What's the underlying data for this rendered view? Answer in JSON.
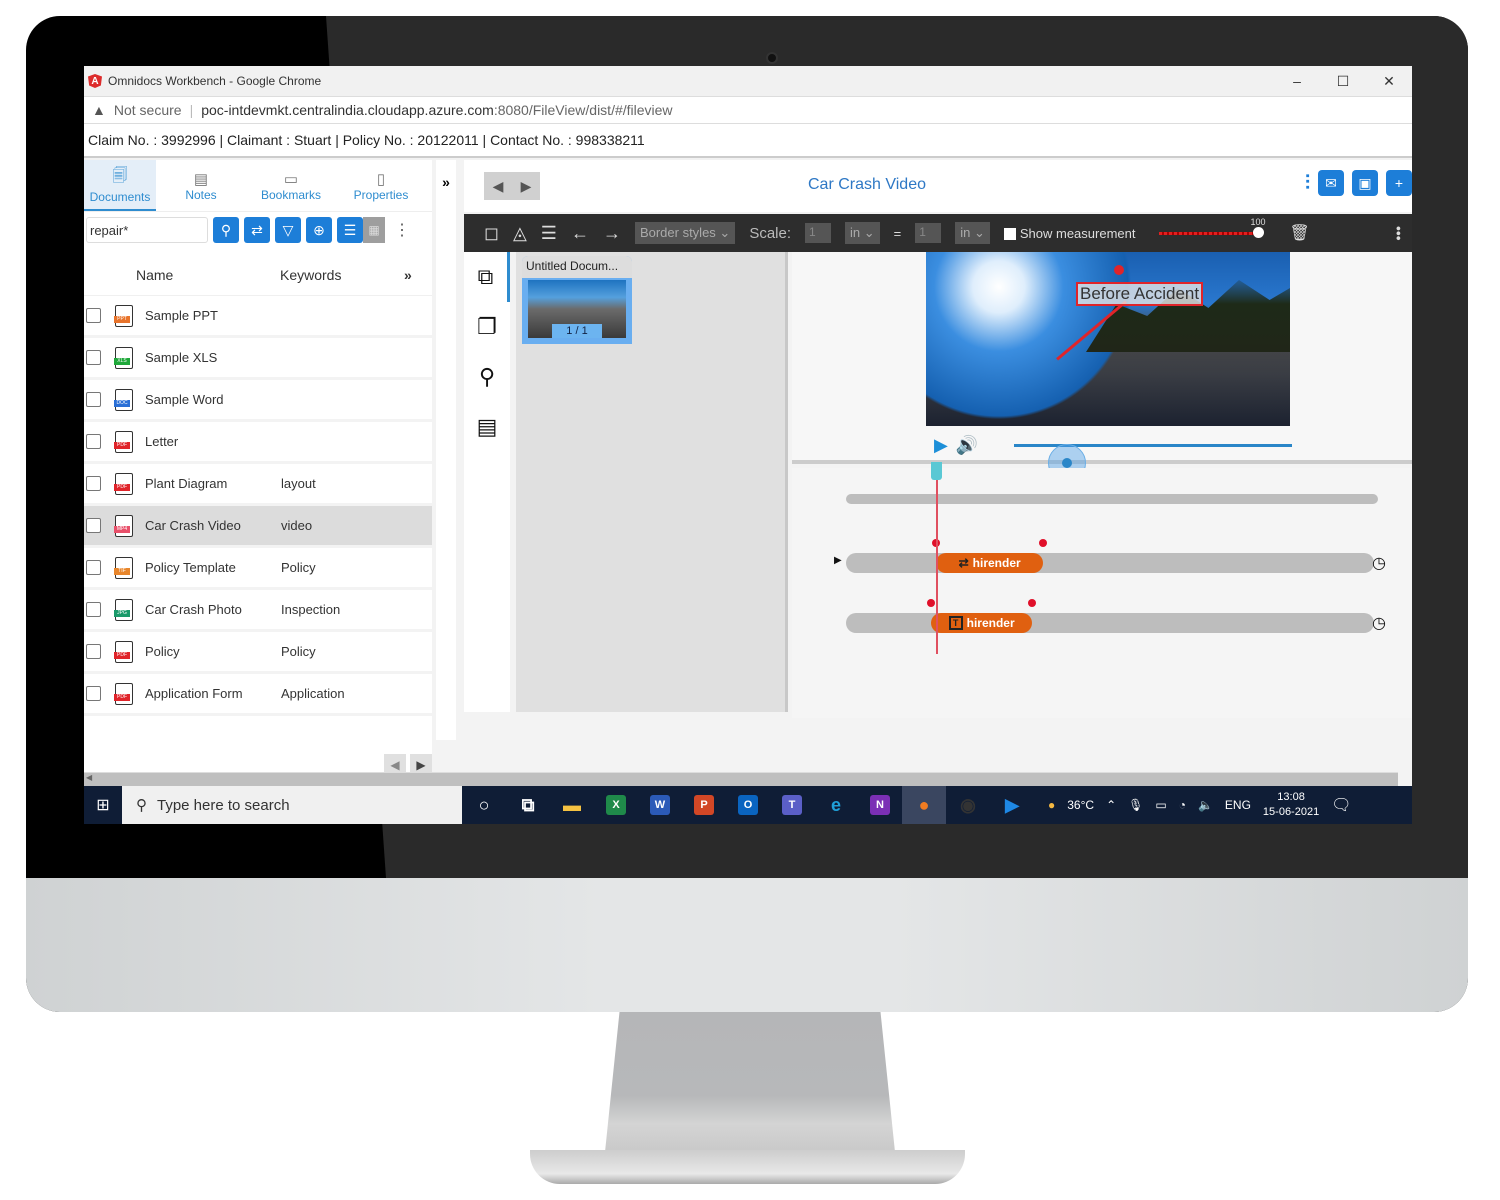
{
  "window": {
    "title": "Omnidocs Workbench - Google Chrome",
    "controls": {
      "minimize": "–",
      "maximize": "☐",
      "close": "✕"
    }
  },
  "address_bar": {
    "security_label": "Not secure",
    "url_host": "poc-intdevmkt.centralindia.cloudapp.azure.com",
    "url_path": ":8080/FileView/dist/#/fileview"
  },
  "claim_bar": {
    "text": "Claim No. : 3992996 | Claimant : Stuart | Policy No. : 20122011 | Contact No. : 998338211"
  },
  "left_panel": {
    "tabs": [
      {
        "label": "Documents",
        "icon": "documents-icon",
        "active": true
      },
      {
        "label": "Notes",
        "icon": "notes-icon",
        "active": false
      },
      {
        "label": "Bookmarks",
        "icon": "bookmarks-icon",
        "active": false
      },
      {
        "label": "Properties",
        "icon": "properties-icon",
        "active": false
      }
    ],
    "search": {
      "value": "repair*",
      "placeholder": ""
    },
    "columns": {
      "name": "Name",
      "keywords": "Keywords",
      "more": "»"
    },
    "documents": [
      {
        "name": "Sample PPT",
        "keywords": "",
        "type": "PPT",
        "color": "#e8742c",
        "selected": false
      },
      {
        "name": "Sample XLS",
        "keywords": "",
        "type": "XLS",
        "color": "#1fa83a",
        "selected": false
      },
      {
        "name": "Sample Word",
        "keywords": "",
        "type": "DOC",
        "color": "#2a6fd6",
        "selected": false
      },
      {
        "name": "Letter",
        "keywords": "",
        "type": "PDF",
        "color": "#e0242a",
        "selected": false
      },
      {
        "name": "Plant Diagram",
        "keywords": "layout",
        "type": "PDF",
        "color": "#e0242a",
        "selected": false
      },
      {
        "name": "Car Crash Video",
        "keywords": "video",
        "type": "MP4",
        "color": "#e8506a",
        "selected": true
      },
      {
        "name": "Policy Template",
        "keywords": "Policy",
        "type": "TIF",
        "color": "#e8862c",
        "selected": false
      },
      {
        "name": "Car Crash Photo",
        "keywords": "Inspection",
        "type": "JPG",
        "color": "#1a9a6a",
        "selected": false
      },
      {
        "name": "Policy",
        "keywords": "Policy",
        "type": "PDF",
        "color": "#e0242a",
        "selected": false
      },
      {
        "name": "Application Form",
        "keywords": "Application",
        "type": "PDF",
        "color": "#e0242a",
        "selected": false
      }
    ],
    "pager": {
      "prev": "◀",
      "next": "▶"
    },
    "collapse_label": "»"
  },
  "viewer": {
    "title": "Car Crash Video",
    "nav": {
      "prev": "◀",
      "next": "▶"
    },
    "toolbar": {
      "border_styles": "Border styles ⌄",
      "scale_label": "Scale:",
      "scale_value_1": "1",
      "scale_unit_1": "in ⌄",
      "equals": "=",
      "scale_value_2": "1",
      "scale_unit_2": "in ⌄",
      "show_measurement": "Show measurement",
      "opacity_value": "100"
    },
    "thumbnail": {
      "title": "Untitled Docum...",
      "page": "1 / 1"
    },
    "annotation_label": "Before Accident",
    "playback_progress": 0.19,
    "timeline": {
      "playhead_fraction": 0.17,
      "tracks": [
        {
          "label": "hirender",
          "icon": "transition-icon",
          "start": 0.17,
          "end": 0.37
        },
        {
          "label": "hirender",
          "icon": "text-icon",
          "start": 0.16,
          "end": 0.35
        }
      ]
    }
  },
  "taskbar": {
    "search_placeholder": "Type here to search",
    "apps": [
      {
        "name": "cortana",
        "glyph": "○",
        "color": "#fff"
      },
      {
        "name": "task-view",
        "glyph": "⧉",
        "color": "#fff"
      },
      {
        "name": "file-explorer",
        "glyph": "▬",
        "color": "#f5c242"
      },
      {
        "name": "excel",
        "glyph": "X",
        "color": "#1f8a4a"
      },
      {
        "name": "word",
        "glyph": "W",
        "color": "#2b5ab8"
      },
      {
        "name": "powerpoint",
        "glyph": "P",
        "color": "#d24726"
      },
      {
        "name": "outlook",
        "glyph": "O",
        "color": "#0a64c0"
      },
      {
        "name": "teams",
        "glyph": "T",
        "color": "#5b5fc7"
      },
      {
        "name": "edge",
        "glyph": "e",
        "color": "#1fa0d8"
      },
      {
        "name": "onenote",
        "glyph": "N",
        "color": "#7b2fb5"
      },
      {
        "name": "firefox",
        "glyph": "●",
        "color": "#f07c22"
      },
      {
        "name": "obs",
        "glyph": "◉",
        "color": "#333"
      },
      {
        "name": "media-player",
        "glyph": "▶",
        "color": "#1e88e5"
      }
    ],
    "weather": "36°C",
    "language": "ENG",
    "time": "13:08",
    "date": "15-06-2021"
  }
}
